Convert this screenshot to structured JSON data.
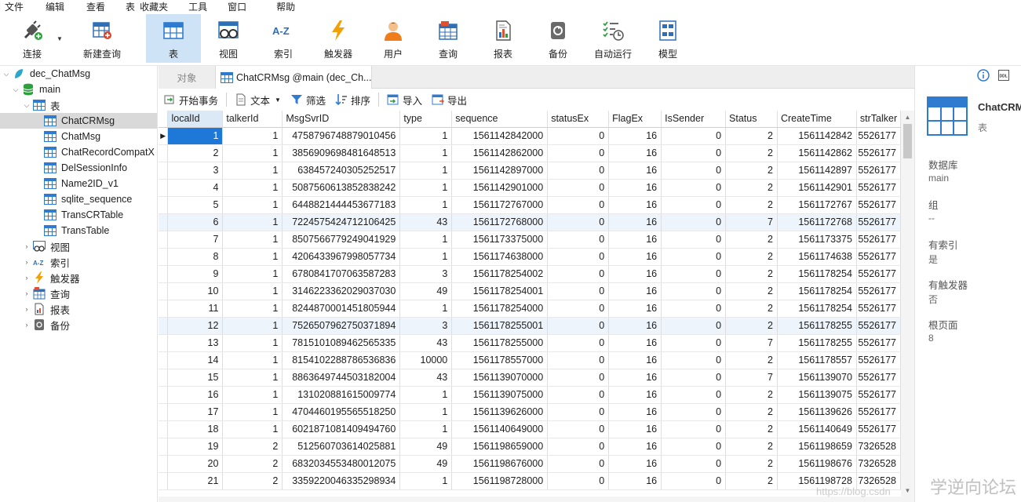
{
  "menu": [
    "文件",
    "编辑",
    "查看",
    "表",
    "收藏夹",
    "工具",
    "窗口",
    "帮助"
  ],
  "toolbar": {
    "connect": "连接",
    "new_query": "新建查询",
    "table": "表",
    "view": "视图",
    "index": "索引",
    "trigger": "触发器",
    "user": "用户",
    "query": "查询",
    "report": "报表",
    "backup": "备份",
    "auto_run": "自动运行",
    "model": "模型"
  },
  "tree": {
    "db": "dec_ChatMsg",
    "schema": "main",
    "tables_label": "表",
    "tables": [
      "ChatCRMsg",
      "ChatMsg",
      "ChatRecordCompatX",
      "DelSessionInfo",
      "Name2ID_v1",
      "sqlite_sequence",
      "TransCRTable",
      "TransTable"
    ],
    "view": "视图",
    "index": "索引",
    "trigger": "触发器",
    "query": "查询",
    "report": "报表",
    "backup": "备份"
  },
  "tabs": {
    "objects": "对象",
    "active": "ChatCRMsg @main (dec_Ch..."
  },
  "subbar": {
    "begin_tx": "开始事务",
    "text": "文本",
    "filter": "筛选",
    "sort": "排序",
    "import": "导入",
    "export": "导出"
  },
  "grid": {
    "columns": [
      "localId",
      "talkerId",
      "MsgSvrID",
      "type",
      "sequence",
      "statusEx",
      "FlagEx",
      "IsSender",
      "Status",
      "CreateTime",
      "strTalker"
    ],
    "rows": [
      [
        "1",
        "1",
        "4758796748879010456",
        "1",
        "1561142842000",
        "0",
        "16",
        "0",
        "2",
        "1561142842",
        "5526177"
      ],
      [
        "2",
        "1",
        "3856909698481648513",
        "1",
        "1561142862000",
        "0",
        "16",
        "0",
        "2",
        "1561142862",
        "5526177"
      ],
      [
        "3",
        "1",
        "638457240305252517",
        "1",
        "1561142897000",
        "0",
        "16",
        "0",
        "2",
        "1561142897",
        "5526177"
      ],
      [
        "4",
        "1",
        "5087560613852838242",
        "1",
        "1561142901000",
        "0",
        "16",
        "0",
        "2",
        "1561142901",
        "5526177"
      ],
      [
        "5",
        "1",
        "6448821444453677183",
        "1",
        "1561172767000",
        "0",
        "16",
        "0",
        "2",
        "1561172767",
        "5526177"
      ],
      [
        "6",
        "1",
        "7224575424712106425",
        "43",
        "1561172768000",
        "0",
        "16",
        "0",
        "7",
        "1561172768",
        "5526177"
      ],
      [
        "7",
        "1",
        "8507566779249041929",
        "1",
        "1561173375000",
        "0",
        "16",
        "0",
        "2",
        "1561173375",
        "5526177"
      ],
      [
        "8",
        "1",
        "4206433967998057734",
        "1",
        "1561174638000",
        "0",
        "16",
        "0",
        "2",
        "1561174638",
        "5526177"
      ],
      [
        "9",
        "1",
        "6780841707063587283",
        "3",
        "1561178254002",
        "0",
        "16",
        "0",
        "2",
        "1561178254",
        "5526177"
      ],
      [
        "10",
        "1",
        "3146223362029037030",
        "49",
        "1561178254001",
        "0",
        "16",
        "0",
        "2",
        "1561178254",
        "5526177"
      ],
      [
        "11",
        "1",
        "8244870001451805944",
        "1",
        "1561178254000",
        "0",
        "16",
        "0",
        "2",
        "1561178254",
        "5526177"
      ],
      [
        "12",
        "1",
        "7526507962750371894",
        "3",
        "1561178255001",
        "0",
        "16",
        "0",
        "2",
        "1561178255",
        "5526177"
      ],
      [
        "13",
        "1",
        "7815101089462565335",
        "43",
        "1561178255000",
        "0",
        "16",
        "0",
        "7",
        "1561178255",
        "5526177"
      ],
      [
        "14",
        "1",
        "8154102288786536836",
        "10000",
        "1561178557000",
        "0",
        "16",
        "0",
        "2",
        "1561178557",
        "5526177"
      ],
      [
        "15",
        "1",
        "8863649744503182004",
        "43",
        "1561139070000",
        "0",
        "16",
        "0",
        "7",
        "1561139070",
        "5526177"
      ],
      [
        "16",
        "1",
        "131020881615009774",
        "1",
        "1561139075000",
        "0",
        "16",
        "0",
        "2",
        "1561139075",
        "5526177"
      ],
      [
        "17",
        "1",
        "4704460195565518250",
        "1",
        "1561139626000",
        "0",
        "16",
        "0",
        "2",
        "1561139626",
        "5526177"
      ],
      [
        "18",
        "1",
        "6021871081409494760",
        "1",
        "1561140649000",
        "0",
        "16",
        "0",
        "2",
        "1561140649",
        "5526177"
      ],
      [
        "19",
        "2",
        "512560703614025881",
        "49",
        "1561198659000",
        "0",
        "16",
        "0",
        "2",
        "1561198659",
        "7326528"
      ],
      [
        "20",
        "2",
        "6832034553480012075",
        "49",
        "1561198676000",
        "0",
        "16",
        "0",
        "2",
        "1561198676",
        "7326528"
      ],
      [
        "21",
        "2",
        "3359220046335298934",
        "1",
        "1561198728000",
        "0",
        "16",
        "0",
        "2",
        "1561198728",
        "7326528"
      ]
    ]
  },
  "info": {
    "name": "ChatCRMsg",
    "type": "表",
    "fields": [
      {
        "label": "数据库",
        "value": "main"
      },
      {
        "label": "组",
        "value": "--"
      },
      {
        "label": "有索引",
        "value": "是"
      },
      {
        "label": "有触发器",
        "value": "否"
      },
      {
        "label": "根页面",
        "value": "8"
      }
    ]
  },
  "watermark": "学逆向论坛",
  "watermark_url": "https://blog.csdn"
}
